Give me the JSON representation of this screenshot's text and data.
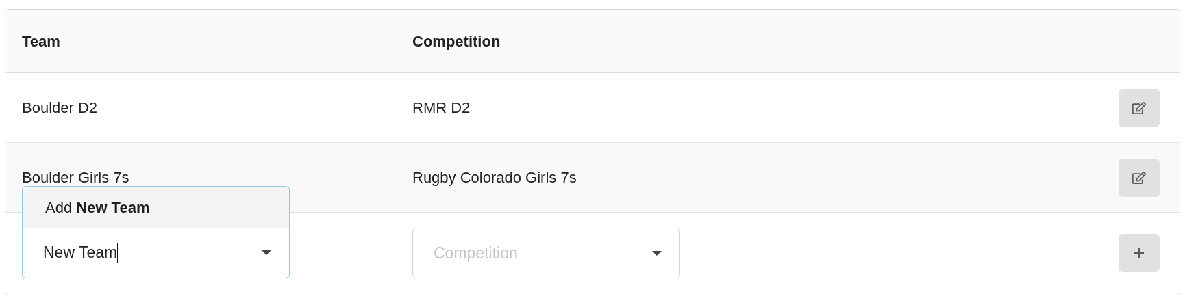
{
  "table": {
    "columns": [
      "Team",
      "Competition"
    ],
    "rows": [
      {
        "team": "Boulder D2",
        "competition": "RMR D2",
        "action": {
          "kind": "edit"
        }
      },
      {
        "team": "Boulder Girls 7s",
        "competition": "Rugby Colorado Girls 7s",
        "action": {
          "kind": "edit"
        }
      }
    ],
    "new_row": {
      "team_field": {
        "value": "New Team",
        "menu_open": true,
        "menu_options": [
          "Add **New Team**"
        ]
      },
      "competition_field": {
        "placeholder": "Competition"
      },
      "action": {
        "kind": "add"
      }
    }
  }
}
